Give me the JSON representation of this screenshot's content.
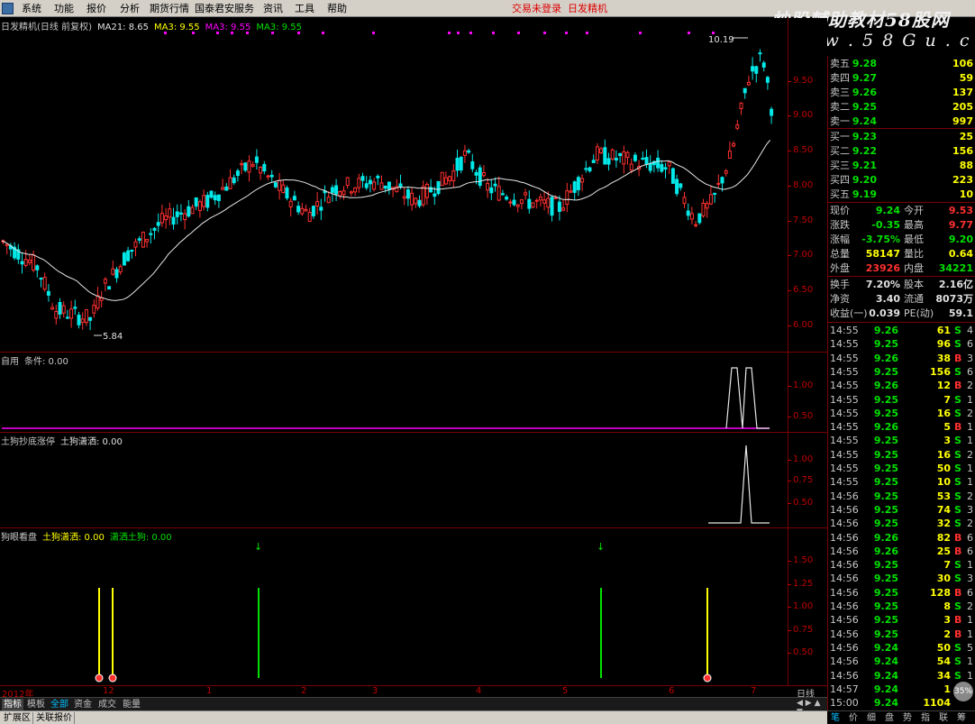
{
  "menu": {
    "items": [
      "系统",
      "功能",
      "报价",
      "分析",
      "期货行情",
      "国泰君安服务",
      "资讯",
      "工具",
      "帮助"
    ],
    "trade_status": "交易未登录",
    "stock_name": "日发精机"
  },
  "watermark": {
    "line1": "炒股輔助教材58股网",
    "line2": "w w w . 5 8 G u . c o m"
  },
  "main_panel": {
    "title": "日发精机(日线 前复权)",
    "indicators": [
      {
        "label": "MA21: 8.65",
        "color": "#e0e0e0"
      },
      {
        "label": "MA3: 9.55",
        "color": "#ffff00"
      },
      {
        "label": "MA3: 9.55",
        "color": "#ff00ff"
      },
      {
        "label": "MA3: 9.55",
        "color": "#00e000"
      }
    ],
    "high_label": "10.19",
    "low_label": "5.84",
    "yticks": [
      "9.50",
      "9.00",
      "8.50",
      "8.00",
      "7.50",
      "7.00",
      "6.50",
      "6.00"
    ]
  },
  "panel2": {
    "title": "自用",
    "indicators": [
      {
        "label": "条件: 0.00",
        "color": "#c8c8c8"
      }
    ],
    "yticks": [
      "1.00",
      "0.50"
    ]
  },
  "panel3": {
    "title": "土狗抄底涨停",
    "indicators": [
      {
        "label": "土狗潇洒: 0.00",
        "color": "#e0e0e0"
      }
    ],
    "yticks": [
      "1.00",
      "0.75",
      "0.50"
    ]
  },
  "panel4": {
    "title": "狗眼看盘",
    "indicators": [
      {
        "label": "土狗潇洒: 0.00",
        "color": "#ffff00"
      },
      {
        "label": "潇洒土狗: 0.00",
        "color": "#00e000"
      }
    ],
    "yticks": [
      "1.50",
      "1.25",
      "1.00",
      "0.75",
      "0.50"
    ]
  },
  "xaxis": {
    "labels": [
      "2012年",
      "12",
      "1",
      "2",
      "3",
      "4",
      "5",
      "6",
      "7"
    ],
    "period": "日线"
  },
  "bottom_tabs": [
    "指标",
    "模板",
    "全部",
    "资金",
    "成交",
    "能量"
  ],
  "status_buttons": [
    "扩展区",
    "关联报价"
  ],
  "orderbook": {
    "asks": [
      {
        "label": "卖五",
        "price": "9.28",
        "vol": "106"
      },
      {
        "label": "卖四",
        "price": "9.27",
        "vol": "59"
      },
      {
        "label": "卖三",
        "price": "9.26",
        "vol": "137"
      },
      {
        "label": "卖二",
        "price": "9.25",
        "vol": "205"
      },
      {
        "label": "卖一",
        "price": "9.24",
        "vol": "997"
      }
    ],
    "bids": [
      {
        "label": "买一",
        "price": "9.23",
        "vol": "25"
      },
      {
        "label": "买二",
        "price": "9.22",
        "vol": "156"
      },
      {
        "label": "买三",
        "price": "9.21",
        "vol": "88"
      },
      {
        "label": "买四",
        "price": "9.20",
        "vol": "223"
      },
      {
        "label": "买五",
        "price": "9.19",
        "vol": "10"
      }
    ]
  },
  "stats": [
    {
      "l1": "现价",
      "v1": "9.24",
      "c1": "green",
      "l2": "今开",
      "v2": "9.53",
      "c2": "red"
    },
    {
      "l1": "涨跌",
      "v1": "-0.35",
      "c1": "green",
      "l2": "最高",
      "v2": "9.77",
      "c2": "red"
    },
    {
      "l1": "涨幅",
      "v1": "-3.75%",
      "c1": "green",
      "l2": "最低",
      "v2": "9.20",
      "c2": "green"
    },
    {
      "l1": "总量",
      "v1": "58147",
      "c1": "yellow",
      "l2": "量比",
      "v2": "0.64",
      "c2": "yellow"
    },
    {
      "l1": "外盘",
      "v1": "23926",
      "c1": "red",
      "l2": "内盘",
      "v2": "34221",
      "c2": "green"
    },
    {
      "l1": "换手",
      "v1": "7.20%",
      "c1": "white",
      "l2": "股本",
      "v2": "2.16亿",
      "c2": "white"
    },
    {
      "l1": "净资",
      "v1": "3.40",
      "c1": "white",
      "l2": "流通",
      "v2": "8073万",
      "c2": "white"
    },
    {
      "l1": "收益(一)",
      "v1": "0.039",
      "c1": "white",
      "l2": "PE(动)",
      "v2": "59.1",
      "c2": "white"
    }
  ],
  "ticks": [
    {
      "t": "14:55",
      "p": "9.26",
      "v": "61",
      "s": "S",
      "n": "4"
    },
    {
      "t": "14:55",
      "p": "9.25",
      "v": "96",
      "s": "S",
      "n": "6"
    },
    {
      "t": "14:55",
      "p": "9.26",
      "v": "38",
      "s": "B",
      "n": "3"
    },
    {
      "t": "14:55",
      "p": "9.25",
      "v": "156",
      "s": "S",
      "n": "6"
    },
    {
      "t": "14:55",
      "p": "9.26",
      "v": "12",
      "s": "B",
      "n": "2"
    },
    {
      "t": "14:55",
      "p": "9.25",
      "v": "7",
      "s": "S",
      "n": "1"
    },
    {
      "t": "14:55",
      "p": "9.25",
      "v": "16",
      "s": "S",
      "n": "2"
    },
    {
      "t": "14:55",
      "p": "9.26",
      "v": "5",
      "s": "B",
      "n": "1"
    },
    {
      "t": "14:55",
      "p": "9.25",
      "v": "3",
      "s": "S",
      "n": "1"
    },
    {
      "t": "14:55",
      "p": "9.25",
      "v": "16",
      "s": "S",
      "n": "2"
    },
    {
      "t": "14:55",
      "p": "9.25",
      "v": "50",
      "s": "S",
      "n": "1"
    },
    {
      "t": "14:55",
      "p": "9.25",
      "v": "10",
      "s": "S",
      "n": "1"
    },
    {
      "t": "14:56",
      "p": "9.25",
      "v": "53",
      "s": "S",
      "n": "2"
    },
    {
      "t": "14:56",
      "p": "9.25",
      "v": "74",
      "s": "S",
      "n": "3"
    },
    {
      "t": "14:56",
      "p": "9.25",
      "v": "32",
      "s": "S",
      "n": "2"
    },
    {
      "t": "14:56",
      "p": "9.26",
      "v": "82",
      "s": "B",
      "n": "6"
    },
    {
      "t": "14:56",
      "p": "9.26",
      "v": "25",
      "s": "B",
      "n": "6"
    },
    {
      "t": "14:56",
      "p": "9.25",
      "v": "7",
      "s": "S",
      "n": "1"
    },
    {
      "t": "14:56",
      "p": "9.25",
      "v": "30",
      "s": "S",
      "n": "3"
    },
    {
      "t": "14:56",
      "p": "9.25",
      "v": "128",
      "s": "B",
      "n": "6"
    },
    {
      "t": "14:56",
      "p": "9.25",
      "v": "8",
      "s": "S",
      "n": "2"
    },
    {
      "t": "14:56",
      "p": "9.25",
      "v": "3",
      "s": "B",
      "n": "1"
    },
    {
      "t": "14:56",
      "p": "9.25",
      "v": "2",
      "s": "B",
      "n": "1"
    },
    {
      "t": "14:56",
      "p": "9.24",
      "v": "50",
      "s": "S",
      "n": "5"
    },
    {
      "t": "14:56",
      "p": "9.24",
      "v": "54",
      "s": "S",
      "n": "1"
    },
    {
      "t": "14:56",
      "p": "9.24",
      "v": "34",
      "s": "S",
      "n": "1"
    },
    {
      "t": "14:57",
      "p": "9.24",
      "v": "1",
      "s": "",
      "n": ""
    },
    {
      "t": "15:00",
      "p": "9.24",
      "v": "1104",
      "s": "",
      "n": ""
    }
  ],
  "quote_tabs": [
    "笔",
    "价",
    "细",
    "盘",
    "势",
    "指",
    "联",
    "筹"
  ],
  "badge": "35%"
}
